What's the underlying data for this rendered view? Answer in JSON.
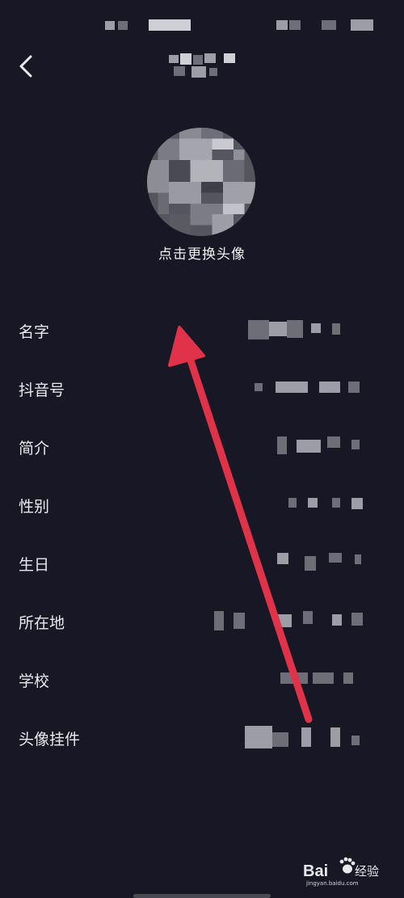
{
  "header": {
    "back_icon": "chevron-left-icon"
  },
  "avatar": {
    "change_label": "点击更换头像"
  },
  "profile_fields": [
    {
      "label": "名字"
    },
    {
      "label": "抖音号"
    },
    {
      "label": "简介"
    },
    {
      "label": "性别"
    },
    {
      "label": "生日"
    },
    {
      "label": "所在地"
    },
    {
      "label": "学校"
    },
    {
      "label": "头像挂件"
    }
  ],
  "annotation": {
    "arrow_color": "#e0334a"
  },
  "watermark": {
    "brand": "Bai",
    "brand_suffix": "经验",
    "url": "jingyan.baidu.com"
  },
  "colors": {
    "background": "#171725",
    "text": "#e9e9ee"
  }
}
